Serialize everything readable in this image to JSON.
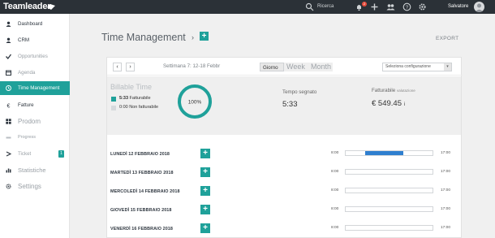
{
  "topbar": {
    "logo": "Teamleader",
    "search_label": "Ricerca",
    "notification_count": "2",
    "user_name": "Salvatore"
  },
  "sidebar": {
    "items": [
      {
        "label": "Dashboard",
        "icon": "user-icon",
        "state": "normal"
      },
      {
        "label": "CRM",
        "icon": "person-icon",
        "state": "normal"
      },
      {
        "label": "Opportunities",
        "icon": "check-icon",
        "state": "dim"
      },
      {
        "label": "Agenda",
        "icon": "calendar-icon",
        "state": "dim"
      },
      {
        "label": "Time Management",
        "icon": "clock-icon",
        "state": "active"
      },
      {
        "label": "Fatture",
        "icon": "euro-icon",
        "state": "normal"
      },
      {
        "label": "Prodom",
        "icon": "grid-icon",
        "state": "dim"
      },
      {
        "label": "Progress",
        "icon": "progress-icon",
        "state": "dim"
      },
      {
        "label": "Ticket",
        "icon": "ticket-icon",
        "state": "dim",
        "badge": "1"
      },
      {
        "label": "Statistiche",
        "icon": "chart-icon",
        "state": "dim"
      },
      {
        "label": "Settings",
        "icon": "gear-icon",
        "state": "dim"
      }
    ]
  },
  "main": {
    "title": "Time Management",
    "export_label": "EXPORT"
  },
  "toolbar": {
    "week_label": "Settimana 7: 12-18 Febbr",
    "view_day": "Giorno",
    "view_week": "Week",
    "view_month": "Month",
    "select_placeholder": "Seleziona configurazione"
  },
  "summary": {
    "billable_title": "Billable Time",
    "billable_value": "5:33",
    "billable_label": "Fatturabile",
    "nonbillable_value": "0:00",
    "nonbillable_label": "Non fatturabile",
    "donut_percent": "100%",
    "donut_fraction": 1.0,
    "time_label": "Tempo segnato",
    "time_value": "5:33",
    "invoiceable_label": "Fatturabile",
    "invoiceable_sub": "valutazione",
    "invoiceable_value": "€ 549.45",
    "invoiceable_suffix": "i"
  },
  "days": [
    {
      "name": "LUNEDÌ 12 FEBBRAIO 2018",
      "start": "8:00",
      "end": "17:00",
      "fill_start": 0.22,
      "fill_end": 0.66
    },
    {
      "name": "MARTEDÌ 13 FEBBRAIO 2018",
      "start": "8:00",
      "end": "17:00",
      "fill_start": 0,
      "fill_end": 0
    },
    {
      "name": "MERCOLEDÌ 14 FEBBRAIO 2018",
      "start": "8:00",
      "end": "17:00",
      "fill_start": 0,
      "fill_end": 0
    },
    {
      "name": "GIOVEDÌ 15 FEBBRAIO 2018",
      "start": "8:00",
      "end": "17:00",
      "fill_start": 0,
      "fill_end": 0
    },
    {
      "name": "VENERDÌ 16 FEBBRAIO 2018",
      "start": "8:00",
      "end": "17:00",
      "fill_start": 0,
      "fill_end": 0
    }
  ],
  "colors": {
    "accent": "#1fa19a",
    "bar": "#2f7fcf",
    "topbar": "#2b3137"
  }
}
